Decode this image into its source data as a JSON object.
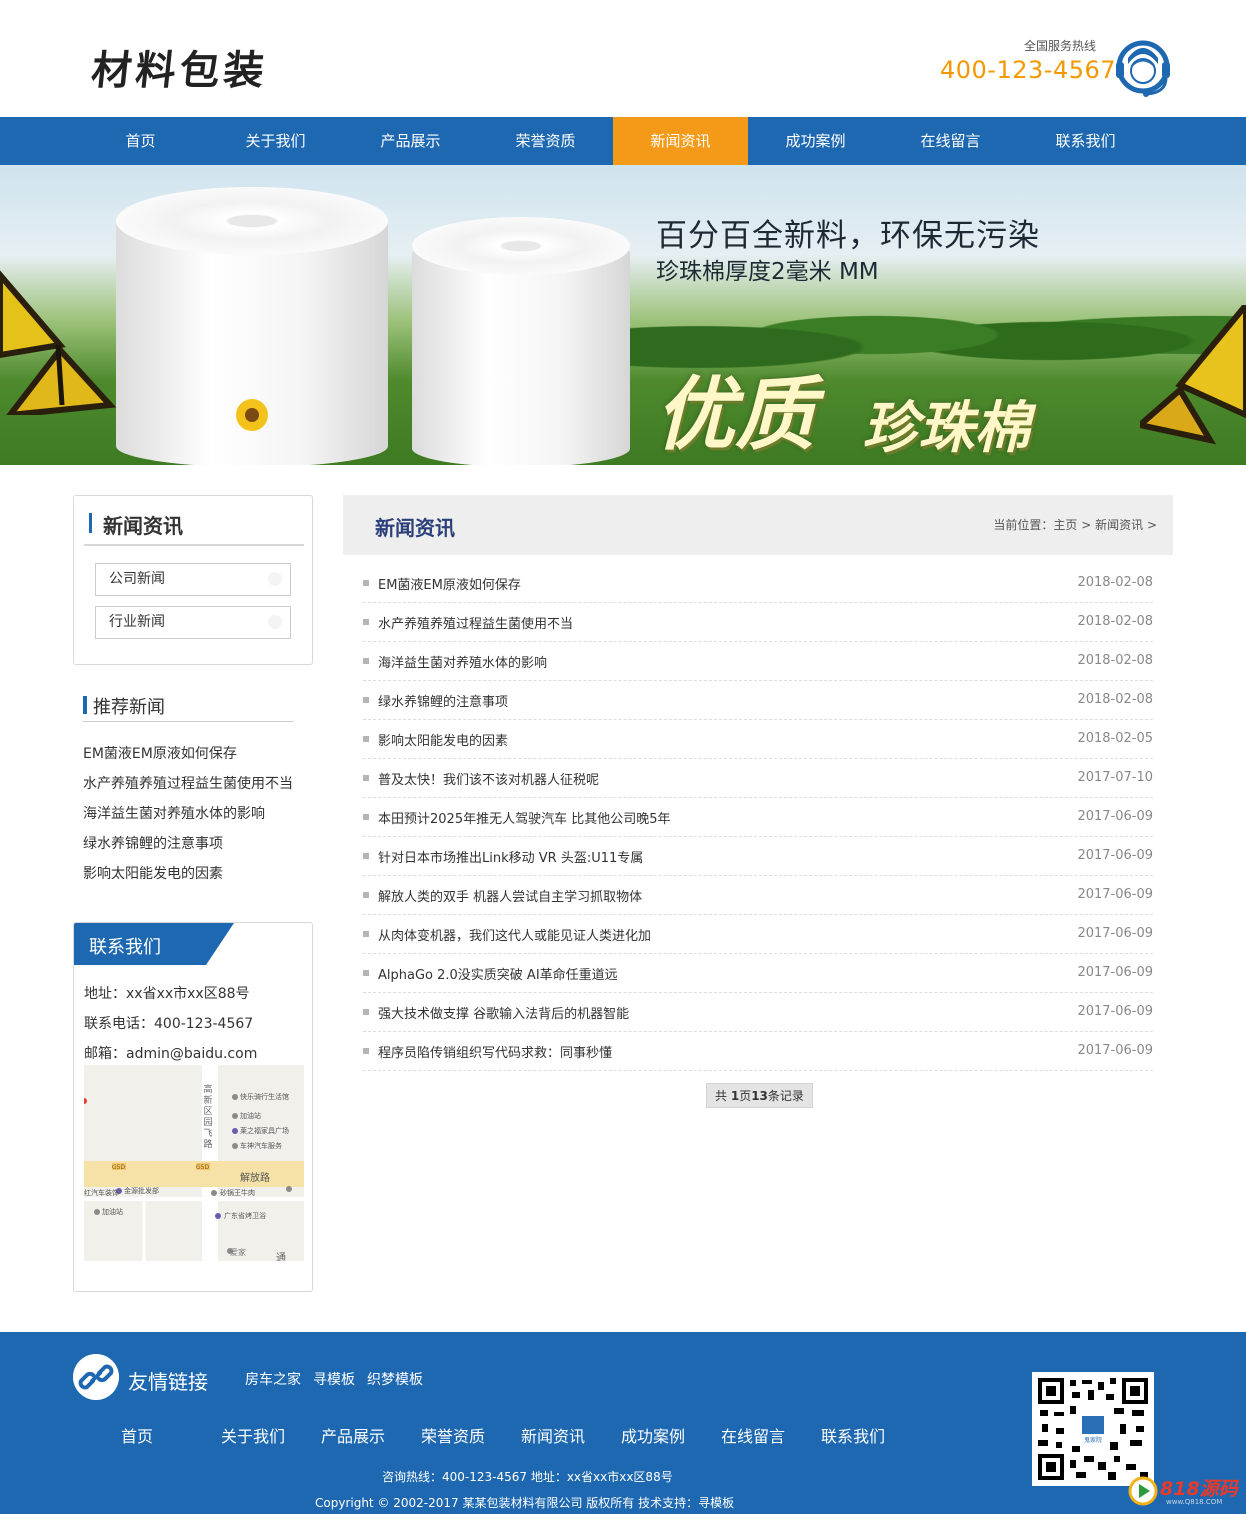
{
  "header": {
    "logo": "材料包装",
    "hotline_label": "全国服务热线",
    "hotline_number": "400-123-4567"
  },
  "nav": {
    "items": [
      {
        "label": "首页"
      },
      {
        "label": "关于我们"
      },
      {
        "label": "产品展示"
      },
      {
        "label": "荣誉资质"
      },
      {
        "label": "新闻资讯"
      },
      {
        "label": "成功案例"
      },
      {
        "label": "在线留言"
      },
      {
        "label": "联系我们"
      }
    ],
    "active_index": 4
  },
  "banner": {
    "line1": "百分百全新料，环保无污染",
    "line2": "珍珠棉厚度2毫米 MM",
    "big1": "优质",
    "big2": "珍珠棉"
  },
  "sidebar": {
    "category_title": "新闻资讯",
    "categories": [
      "公司新闻",
      "行业新闻"
    ],
    "recommend_title": "推荐新闻",
    "recommend": [
      "EM菌液EM原液如何保存",
      "水产养殖养殖过程益生菌使用不当",
      "海洋益生菌对养殖水体的影响",
      "绿水养锦鲤的注意事项",
      "影响太阳能发电的因素"
    ],
    "contact": {
      "title": "联系我们",
      "address": "地址：xx省xx市xx区88号",
      "phone": "联系电话：400-123-4567",
      "email": "邮箱：admin@baidu.com",
      "map_labels": {
        "road_v": "高新区园飞路",
        "road_h": "解放路",
        "poi1": "快乐骑行生活馆",
        "poi2": "加油站",
        "poi3": "莱之福家具广场",
        "poi4": "车神汽车服务",
        "poi5": "金源批发部",
        "poi6": "红汽车装饰",
        "poi7": "加油站",
        "poi8": "砂锅王牛肉",
        "poi9": "广东省烤卫浴",
        "poi10": "爱家",
        "poi11": "通",
        "shield1": "G5D",
        "shield2": "G5D"
      }
    }
  },
  "main": {
    "title": "新闻资讯",
    "breadcrumb": {
      "prefix": "当前位置：",
      "home": "主页",
      "sep1": " > ",
      "current": "新闻资讯",
      "sep2": " >"
    },
    "news": [
      {
        "title": "EM菌液EM原液如何保存",
        "date": "2018-02-08"
      },
      {
        "title": "水产养殖养殖过程益生菌使用不当",
        "date": "2018-02-08"
      },
      {
        "title": "海洋益生菌对养殖水体的影响",
        "date": "2018-02-08"
      },
      {
        "title": "绿水养锦鲤的注意事项",
        "date": "2018-02-08"
      },
      {
        "title": "影响太阳能发电的因素",
        "date": "2018-02-05"
      },
      {
        "title": "普及太快！我们该不该对机器人征税呢",
        "date": "2017-07-10"
      },
      {
        "title": "本田预计2025年推无人驾驶汽车 比其他公司晚5年",
        "date": "2017-06-09"
      },
      {
        "title": "针对日本市场推出Link移动 VR 头盔:U11专属",
        "date": "2017-06-09"
      },
      {
        "title": "解放人类的双手 机器人尝试自主学习抓取物体",
        "date": "2017-06-09"
      },
      {
        "title": "从肉体变机器，我们这代人或能见证人类进化加",
        "date": "2017-06-09"
      },
      {
        "title": "AlphaGo 2.0没实质突破 AI革命任重道远",
        "date": "2017-06-09"
      },
      {
        "title": "强大技术做支撑 谷歌输入法背后的机器智能",
        "date": "2017-06-09"
      },
      {
        "title": "程序员陷传销组织写代码求救：同事秒懂",
        "date": "2017-06-09"
      }
    ],
    "pager": {
      "p1": "共 ",
      "pages": "1",
      "p2": "页",
      "records": "13",
      "p3": "条记录"
    }
  },
  "footer": {
    "links_title": "友情链接",
    "links": [
      "房车之家",
      "寻模板",
      "织梦模板"
    ],
    "nav": [
      "首页",
      "关于我们",
      "产品展示",
      "荣誉资质",
      "新闻资讯",
      "成功案例",
      "在线留言",
      "联系我们"
    ],
    "info": "咨询热线：400-123-4567 地址：xx省xx市xx区88号",
    "copyright": "Copyright © 2002-2017 某某包装材料有限公司 版权所有 技术支持：寻模板",
    "qr_caption": "鬼家院",
    "watermark": "818源码",
    "watermark_sub": "www.Q818.COM"
  },
  "colors": {
    "nav_blue": "#1d68b0",
    "active_orange": "#f59a18",
    "hotline_orange": "#f39800",
    "main_title": "#2b3f7a"
  },
  "icons": {
    "service": "customer-service-headset-icon",
    "link": "chain-link-icon",
    "qr": "qr-code-icon"
  }
}
